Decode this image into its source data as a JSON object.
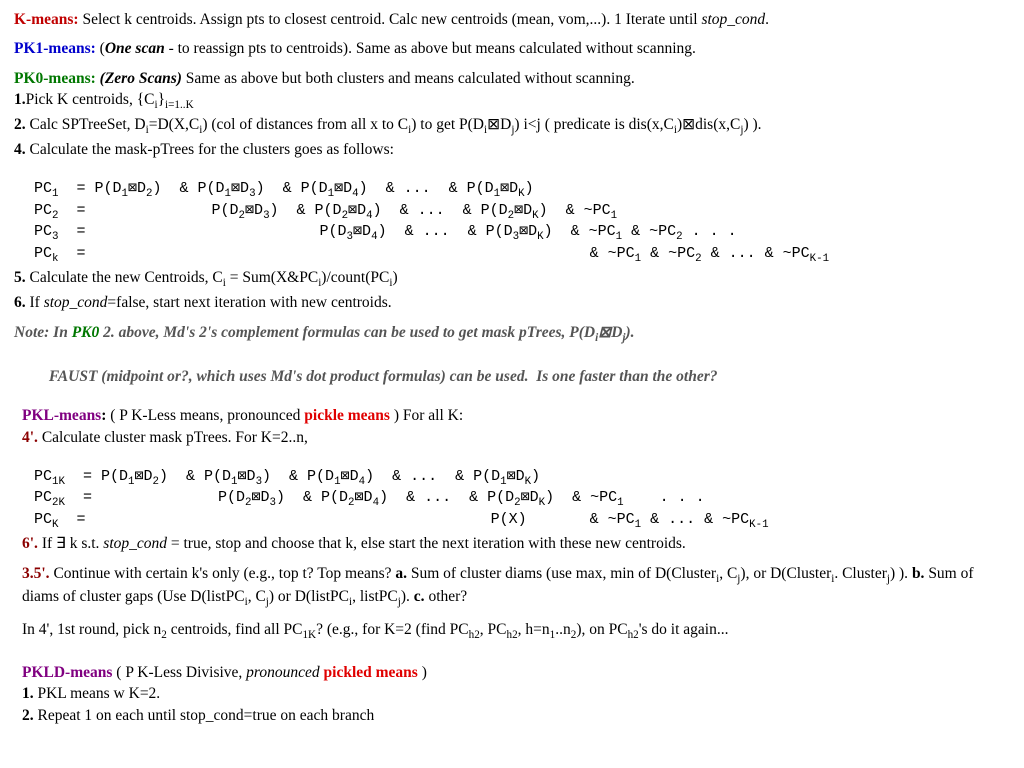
{
  "kmeans": {
    "title": "K-means:",
    "text": " Select k centroids.  Assign pts to closest centroid. Calc new centroids (mean, vom,...).  1 Iterate until  ",
    "stop": "stop_cond",
    "period": "."
  },
  "pk1": {
    "title": "PK1-means:",
    "lead": "  (",
    "onescan": "One scan",
    "rest": " - to reassign pts to centroids). Same as above but means calculated without scanning."
  },
  "pk0": {
    "title": "PK0-means:",
    "lead": " ",
    "zeroscan": "(Zero Scans)",
    "rest": " Same as above but both clusters and means calculated without scanning."
  },
  "steps": {
    "s1a": "1.",
    "s1b": "Pick K centroids, {C",
    "s1c": "i",
    "s1d": "}",
    "s1e": "i=1..K",
    "s2a": "2.",
    "s2b": "  Calc SPTreeSet, D",
    "s2c": "i",
    "s2d": "=D(X,C",
    "s2e": "i",
    "s2f": ") (col of distances from all x to C",
    "s2g": "i",
    "s2h": ") to get   P(D",
    "s2i": "i",
    "s2sq": "⊠",
    "s2j": "D",
    "s2k": "j",
    "s2l": ")   i<j  ( predicate is dis(x,C",
    "s2m": "i",
    "s2n": ")",
    "s2sq2": "⊠",
    "s2o": "dis(x,C",
    "s2p": "j",
    "s2q": ") ).",
    "s4a": "4.",
    "s4b": "  Calculate the mask-pTrees for the clusters goes as follows:"
  },
  "pc_block": "   PC1  = P(D1⊠D2)  & P(D1⊠D3)  & P(D1⊠D4)  & ...  & P(D1⊠DK)\n   PC2  =              P(D2⊠D3)  & P(D2⊠D4)  & ...  & P(D2⊠DK)  & ~PC1\n   PC3  =                          P(D3⊠D4)  & ...  & P(D3⊠DK)  & ~PC1 & ~PC2 . . .\n   PCk  =                                                        & ~PC1 & ~PC2 & ... & ~PCK-1",
  "s5": {
    "a": "5.",
    "b": "  Calculate the new Centroids,  C",
    "c": "i",
    "d": " = Sum(X&PC",
    "e": "i",
    "f": ")/count(PC",
    "g": "i",
    "h": ")"
  },
  "s6": {
    "a": "6.",
    "b": "  If ",
    "c": "stop_cond",
    "d": "=false, start next iteration with new centroids."
  },
  "note": {
    "a": "Note: In ",
    "b": "PK0",
    "c": " 2. above, Md's 2's complement formulas can be used to get mask pTrees, P(D",
    "d": "i",
    "sq": "⊠",
    "e": "D",
    "f": "j",
    "g": ").",
    "h": "         FAUST (midpoint or?, which uses Md's dot product formulas) can be used.  Is one faster than the other?"
  },
  "pkl": {
    "title": "PKL-means",
    "colon": ":",
    "lead": "  ( P K-Less means, pronounced ",
    "pickle": "pickle means",
    "rest": " )   For all K:",
    "s4a": "4'.",
    "s4b": " Calculate cluster mask pTrees.   For K=2..n,"
  },
  "pkl_block": "   PC1K  = P(D1⊠D2)  & P(D1⊠D3)  & P(D1⊠D4)  & ...  & P(D1⊠DK)\n   PC2K  =              P(D2⊠D3)  & P(D2⊠D4)  & ...  & P(D2⊠DK)  & ~PC1    . . .\n   PCK  =                                             P(X)       & ~PC1 & ... & ~PCK-1",
  "s6p": {
    "a": "6'.",
    "b": " If ",
    "exists": "∃",
    "c": " k s.t. ",
    "d": "stop_cond",
    "e": " = true, stop and choose that k, else start the next iteration with these new centroids."
  },
  "s35": {
    "a": "3.5'.",
    "b": " Continue with certain k's only (e.g., top t?  Top means?   ",
    "la": "a.",
    "ta": " Sum of cluster diams (use max, min of D(Cluster",
    "sa1": "i",
    "ta2": ", C",
    "sa2": "j",
    "ta3": "), or D(Cluster",
    "sa3": "i",
    "ta4": ". Cluster",
    "sa4": "j",
    "ta5": ") ).   ",
    "lb": "b.",
    "tb": " Sum of diams of cluster gaps (Use D(listPC",
    "sb1": "i",
    "tb2": ", C",
    "sb2": "j",
    "tb3": ") or D(listPC",
    "sb3": "i",
    "tb4": ", listPC",
    "sb4": "j",
    "tb5": ").   ",
    "lc": "c.",
    "tc": " other?"
  },
  "in4": {
    "a": "In 4', 1st round, pick n",
    "b": "2",
    "c": " centroids, find all PC",
    "d": "1K",
    "e": "? (e.g., for K=2 (find PC",
    "f": "h2",
    "g": ", PC",
    "h": "h2",
    "i": ", h=n",
    "j": "1",
    "k": "..n",
    "l": "2",
    "m": "), on PC",
    "n": "h2",
    "o": "'s do it again..."
  },
  "pkld": {
    "title": "PKLD-means",
    "lead": "  ( P K-Less Divisive, ",
    "pron": "pronounced",
    "pickle": " pickled means",
    "rest": " )",
    "s1a": "1.",
    "s1b": " PKL means w K=2.",
    "s2a": "2.",
    "s2b": " Repeat 1 on each until stop_cond=true on each branch"
  }
}
